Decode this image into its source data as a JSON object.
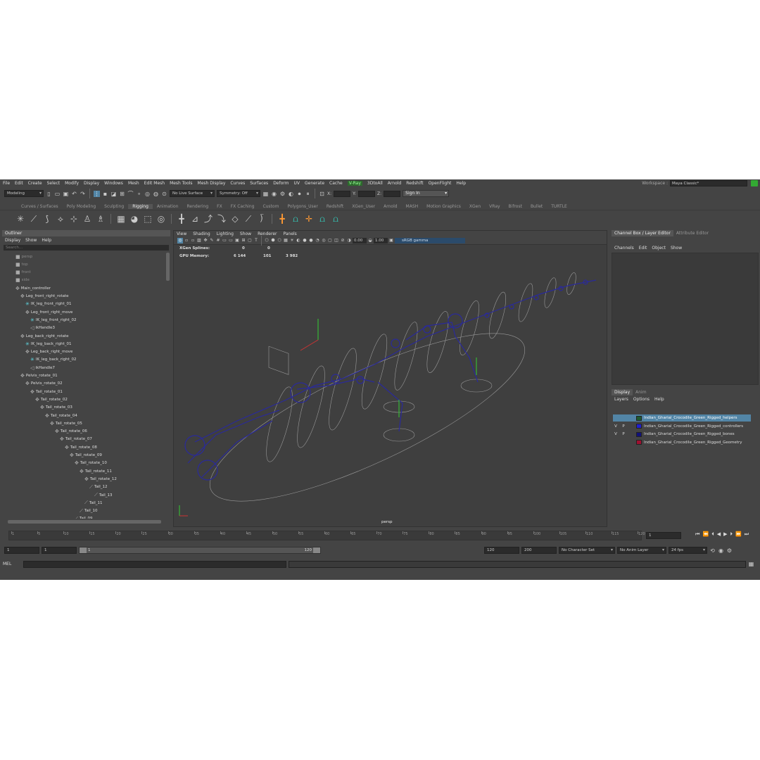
{
  "menu": [
    "File",
    "Edit",
    "Create",
    "Select",
    "Modify",
    "Display",
    "Windows",
    "Mesh",
    "Edit Mesh",
    "Mesh Tools",
    "Mesh Display",
    "Curves",
    "Surfaces",
    "Deform",
    "UV",
    "Generate",
    "Cache",
    "V-Ray",
    "3DtoAll",
    "Arnold",
    "Redshift",
    "OpenFlight",
    "Help"
  ],
  "workspace": {
    "label": "Workspace :",
    "value": "Maya Classic*"
  },
  "status": {
    "mode": "Modeling",
    "live_surface": "No Live Surface",
    "symmetry": "Symmetry: Off",
    "x_label": "X:",
    "y_label": "Y:",
    "z_label": "Z:",
    "sign_in": "Sign In"
  },
  "shelf_tabs": [
    "Curves / Surfaces",
    "Poly Modeling",
    "Sculpting",
    "Rigging",
    "Animation",
    "Rendering",
    "FX",
    "FX Caching",
    "Custom",
    "Polygons_User",
    "Redshift",
    "XGen_User",
    "Arnold",
    "MASH",
    "Motion Graphics",
    "XGen",
    "VRay",
    "Bifrost",
    "Bullet",
    "TURTLE"
  ],
  "shelf_active": "Rigging",
  "outliner": {
    "title": "Outliner",
    "menu": [
      "Display",
      "Show",
      "Help"
    ],
    "search": "Search...",
    "items": [
      {
        "label": "persp",
        "depth": 1,
        "icon": "camera",
        "dim": true
      },
      {
        "label": "top",
        "depth": 1,
        "icon": "camera",
        "dim": true
      },
      {
        "label": "front",
        "depth": 1,
        "icon": "camera",
        "dim": true
      },
      {
        "label": "side",
        "depth": 1,
        "icon": "camera",
        "dim": true
      },
      {
        "label": "Main_controller",
        "depth": 1,
        "icon": "ctrl"
      },
      {
        "label": "Leg_front_right_rotate",
        "depth": 2,
        "icon": "ctrl"
      },
      {
        "label": "IK_leg_front_right_01",
        "depth": 3,
        "icon": "ik"
      },
      {
        "label": "Leg_front_right_move",
        "depth": 3,
        "icon": "ctrl"
      },
      {
        "label": "IK_leg_front_right_02",
        "depth": 4,
        "icon": "ik"
      },
      {
        "label": "ikHandle3",
        "depth": 4,
        "icon": "handle"
      },
      {
        "label": "Leg_back_right_rotate",
        "depth": 2,
        "icon": "ctrl"
      },
      {
        "label": "IK_leg_back_right_01",
        "depth": 3,
        "icon": "ik"
      },
      {
        "label": "Leg_back_right_move",
        "depth": 3,
        "icon": "ctrl"
      },
      {
        "label": "IK_leg_back_right_02",
        "depth": 4,
        "icon": "ik"
      },
      {
        "label": "ikHandle7",
        "depth": 4,
        "icon": "handle"
      },
      {
        "label": "Pelvis_rotate_01",
        "depth": 2,
        "icon": "ctrl"
      },
      {
        "label": "Pelvis_rotate_02",
        "depth": 3,
        "icon": "ctrl"
      },
      {
        "label": "Tail_rotate_01",
        "depth": 4,
        "icon": "ctrl"
      },
      {
        "label": "Tail_rotate_02",
        "depth": 5,
        "icon": "ctrl"
      },
      {
        "label": "Tail_rotate_03",
        "depth": 6,
        "icon": "ctrl"
      },
      {
        "label": "Tail_rotate_04",
        "depth": 7,
        "icon": "ctrl"
      },
      {
        "label": "Tail_rotate_05",
        "depth": 8,
        "icon": "ctrl"
      },
      {
        "label": "Tail_rotate_06",
        "depth": 9,
        "icon": "ctrl"
      },
      {
        "label": "Tail_rotate_07",
        "depth": 10,
        "icon": "ctrl"
      },
      {
        "label": "Tail_rotate_08",
        "depth": 11,
        "icon": "ctrl"
      },
      {
        "label": "Tail_rotate_09",
        "depth": 12,
        "icon": "ctrl"
      },
      {
        "label": "Tail_rotate_10",
        "depth": 13,
        "icon": "ctrl"
      },
      {
        "label": "Tail_rotate_11",
        "depth": 14,
        "icon": "ctrl"
      },
      {
        "label": "Tail_rotate_12",
        "depth": 15,
        "icon": "ctrl"
      },
      {
        "label": "Tail_12",
        "depth": 16,
        "icon": "joint"
      },
      {
        "label": "Tail_13",
        "depth": 17,
        "icon": "joint"
      },
      {
        "label": "Tail_11",
        "depth": 15,
        "icon": "joint"
      },
      {
        "label": "Tail_10",
        "depth": 14,
        "icon": "joint"
      },
      {
        "label": "Tail_09",
        "depth": 13,
        "icon": "joint"
      }
    ]
  },
  "viewport": {
    "menu": [
      "View",
      "Shading",
      "Lighting",
      "Show",
      "Renderer",
      "Panels"
    ],
    "exposure": "0.00",
    "gamma_value": "1.00",
    "color_space": "sRGB gamma",
    "hud": {
      "xgen_label": "XGen Splines:",
      "xgen_a": "0",
      "xgen_b": "0",
      "gpu_label": "GPU Memory:",
      "gpu_a": "6 144",
      "gpu_b": "101",
      "gpu_c": "3 982"
    },
    "camera": "persp"
  },
  "channel_box": {
    "tab_active": "Channel Box / Layer Editor",
    "tab_other": "Attribute Editor",
    "menu": [
      "Channels",
      "Edit",
      "Object",
      "Show"
    ]
  },
  "layer_editor": {
    "tabs": [
      "Display",
      "Anim"
    ],
    "menu": [
      "Layers",
      "Options",
      "Help"
    ],
    "layers": [
      {
        "v": "",
        "p": "",
        "color": "#1f5a32",
        "name": "Indian_Gharial_Crocodile_Green_Rigged_helpers",
        "selected": true
      },
      {
        "v": "V",
        "p": "P",
        "color": "#1f1fcf",
        "name": "Indian_Gharial_Crocodile_Green_Rigged_controllers",
        "selected": false
      },
      {
        "v": "V",
        "p": "P",
        "color": "#12127a",
        "name": "Indian_Gharial_Crocodile_Green_Rigged_bones",
        "selected": false
      },
      {
        "v": "",
        "p": "",
        "color": "#a01030",
        "name": "Indian_Gharial_Crocodile_Green_Rigged_Geometry",
        "selected": false
      }
    ]
  },
  "timeline": {
    "ticks": [
      "1",
      "5",
      "10",
      "15",
      "20",
      "25",
      "30",
      "35",
      "40",
      "45",
      "50",
      "55",
      "60",
      "65",
      "70",
      "75",
      "80",
      "85",
      "90",
      "95",
      "100",
      "105",
      "110",
      "115",
      "120"
    ],
    "current": "1"
  },
  "range": {
    "start": "1",
    "anim_start": "1",
    "slider_min": "1",
    "slider_max": "120",
    "end": "120",
    "anim_end": "200",
    "character": "No Character Set",
    "anim_layer": "No Anim Layer",
    "fps": "24 fps"
  },
  "mel": {
    "label": "MEL"
  }
}
